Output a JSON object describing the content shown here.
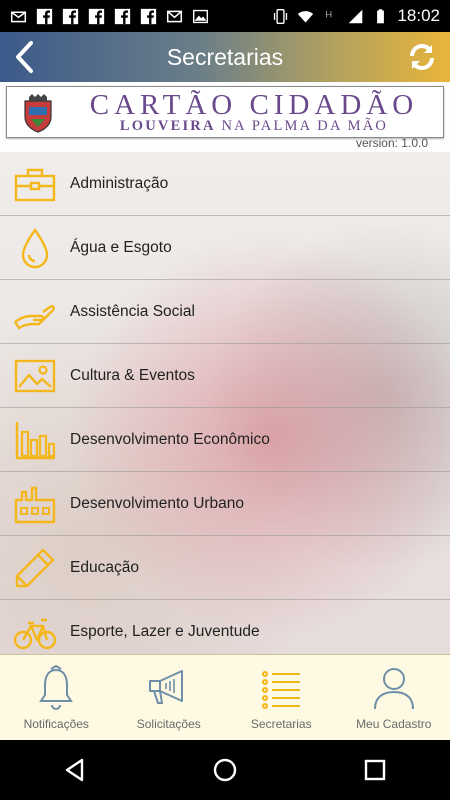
{
  "status_bar": {
    "time": "18:02",
    "icons": [
      "envelope-icon",
      "facebook-icon",
      "facebook-icon",
      "facebook-icon",
      "facebook-icon",
      "facebook-icon",
      "gmail-icon",
      "image-icon",
      "vibrate-icon",
      "wifi-icon",
      "h-signal-icon",
      "signal-icon",
      "battery-icon"
    ]
  },
  "header": {
    "title": "Secretarias",
    "back_icon": "chevron-left-icon",
    "refresh_icon": "refresh-icon"
  },
  "banner": {
    "logo_main": "CARTÃO CIDADÃO",
    "logo_sub_bold": "LOUVEIRA",
    "logo_sub_rest": " NA PALMA DA MÃO",
    "version": "version: 1.0.0"
  },
  "menu": {
    "items": [
      {
        "label": "Administração",
        "icon": "briefcase-icon"
      },
      {
        "label": "Água e Esgoto",
        "icon": "water-drop-icon"
      },
      {
        "label": "Assistência Social",
        "icon": "hand-icon"
      },
      {
        "label": "Cultura & Eventos",
        "icon": "picture-icon"
      },
      {
        "label": "Desenvolvimento Econômico",
        "icon": "bar-chart-icon"
      },
      {
        "label": "Desenvolvimento Urbano",
        "icon": "factory-icon"
      },
      {
        "label": "Educação",
        "icon": "pencil-icon"
      },
      {
        "label": "Esporte, Lazer e Juventude",
        "icon": "bicycle-icon"
      }
    ]
  },
  "tabs": [
    {
      "label": "Notificações",
      "icon": "bell-icon"
    },
    {
      "label": "Solicitações",
      "icon": "megaphone-icon"
    },
    {
      "label": "Secretarias",
      "icon": "list-icon"
    },
    {
      "label": "Meu Cadastro",
      "icon": "person-icon"
    }
  ],
  "colors": {
    "accent": "#f4b71b",
    "header_left": "#3c5a8a",
    "header_right": "#e8b53a",
    "logo_purple": "#6a4a8c",
    "tab_icon": "#6f8fa8"
  }
}
